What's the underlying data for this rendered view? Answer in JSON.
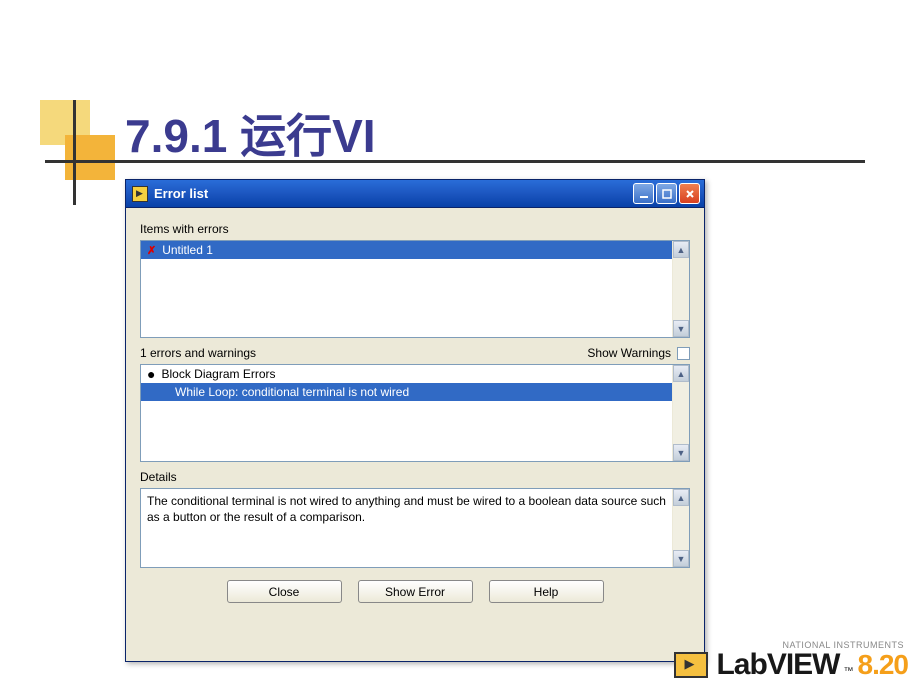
{
  "slide": {
    "title": "7.9.1 运行VI"
  },
  "dialog": {
    "title": "Error list",
    "itemsLabel": "Items with errors",
    "items": [
      {
        "name": "Untitled 1"
      }
    ],
    "errorsCountLabel": "1 errors and warnings",
    "showWarningsLabel": "Show Warnings",
    "errorsList": {
      "category": "Block Diagram Errors",
      "entries": [
        "While Loop: conditional terminal is not wired"
      ]
    },
    "detailsLabel": "Details",
    "detailsText": "The conditional terminal is not wired to anything and must be wired to a boolean data source such as a button or the result of a comparison.",
    "buttons": {
      "close": "Close",
      "showError": "Show Error",
      "help": "Help"
    }
  },
  "footer": {
    "company": "NATIONAL INSTRUMENTS",
    "product": "LabVIEW",
    "version": "8.20"
  }
}
